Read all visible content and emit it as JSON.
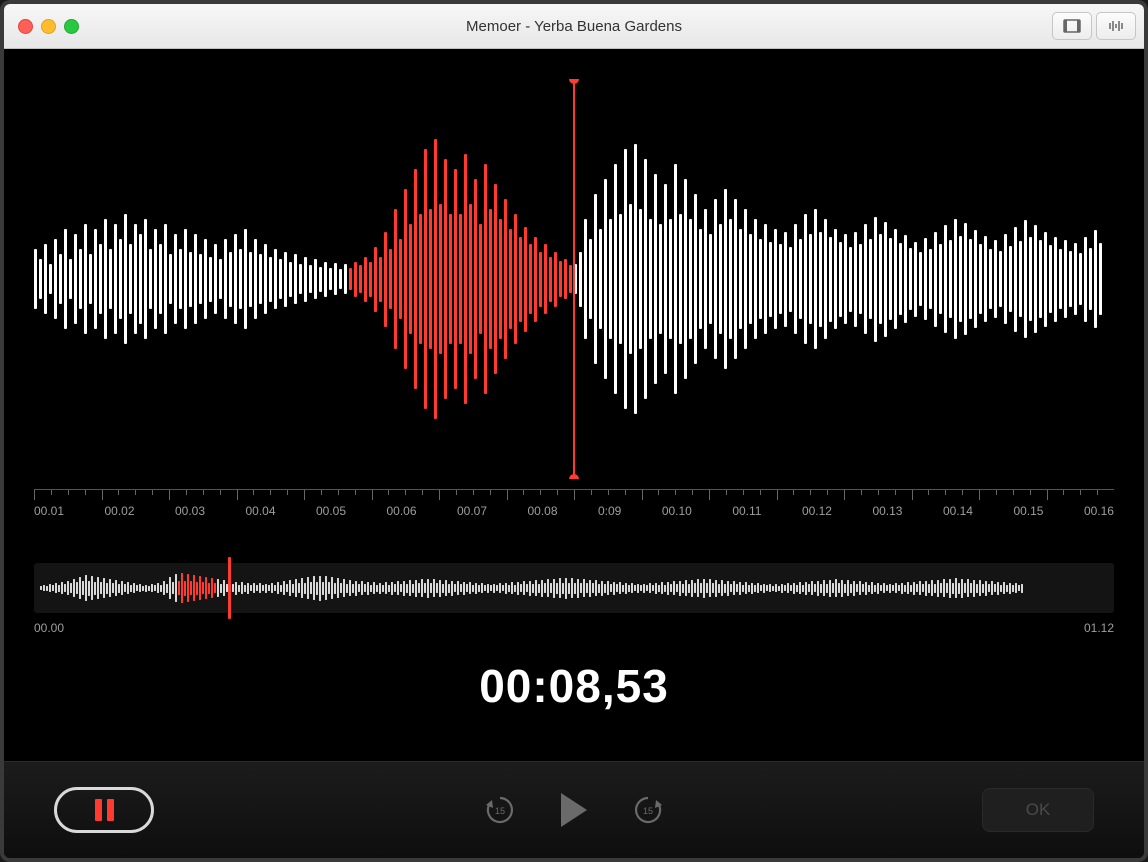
{
  "window": {
    "title": "Memoer - Yerba Buena Gardens"
  },
  "ruler": {
    "labels": [
      "00.01",
      "00.02",
      "00.03",
      "00.04",
      "00.05",
      "00.06",
      "00.07",
      "00.08",
      "0:09",
      "00.10",
      "00.11",
      "00.12",
      "00.13",
      "00.14",
      "00.15",
      "00.16"
    ]
  },
  "overview": {
    "start": "00.00",
    "end": "01.12",
    "playhead_ratio": 0.18
  },
  "timecode": "00:08,53",
  "controls": {
    "ok_label": "OK"
  },
  "waveform": {
    "main": {
      "red_start": 63,
      "red_end": 108,
      "playhead_index": 108,
      "heights": [
        60,
        40,
        70,
        30,
        80,
        50,
        100,
        40,
        90,
        60,
        110,
        50,
        100,
        70,
        120,
        60,
        110,
        80,
        130,
        70,
        110,
        90,
        120,
        60,
        100,
        70,
        110,
        50,
        90,
        60,
        100,
        55,
        90,
        50,
        80,
        45,
        70,
        40,
        80,
        55,
        90,
        60,
        100,
        55,
        80,
        50,
        70,
        45,
        60,
        40,
        55,
        35,
        50,
        30,
        45,
        28,
        40,
        25,
        35,
        22,
        32,
        20,
        30,
        22,
        35,
        28,
        45,
        35,
        65,
        45,
        95,
        60,
        140,
        80,
        180,
        110,
        220,
        130,
        260,
        140,
        280,
        150,
        240,
        130,
        220,
        130,
        250,
        150,
        200,
        110,
        230,
        140,
        190,
        120,
        160,
        100,
        130,
        85,
        105,
        70,
        85,
        55,
        70,
        45,
        55,
        36,
        40,
        28,
        30,
        55,
        120,
        80,
        170,
        100,
        200,
        120,
        230,
        130,
        260,
        150,
        270,
        140,
        240,
        120,
        210,
        110,
        190,
        120,
        230,
        130,
        200,
        120,
        170,
        100,
        140,
        90,
        160,
        110,
        180,
        120,
        160,
        100,
        140,
        90,
        120,
        80,
        110,
        75,
        100,
        70,
        95,
        65,
        110,
        80,
        130,
        90,
        140,
        95,
        120,
        85,
        100,
        75,
        90,
        65,
        95,
        70,
        110,
        80,
        125,
        90,
        115,
        82,
        100,
        72,
        88,
        62,
        75,
        54,
        82,
        60,
        95,
        70,
        108,
        78,
        120,
        86,
        112,
        80,
        98,
        70,
        86,
        60,
        78,
        56,
        90,
        66,
        105,
        76,
        118,
        84,
        108,
        78,
        95,
        68,
        85,
        60,
        78,
        56,
        72,
        52,
        85,
        62,
        98,
        72
      ]
    },
    "overview_heights": [
      4,
      6,
      5,
      8,
      6,
      10,
      7,
      12,
      8,
      14,
      10,
      18,
      12,
      22,
      14,
      26,
      15,
      24,
      13,
      22,
      12,
      20,
      11,
      18,
      10,
      16,
      9,
      14,
      8,
      12,
      7,
      10,
      6,
      8,
      5,
      7,
      5,
      8,
      6,
      10,
      7,
      14,
      9,
      22,
      12,
      28,
      14,
      30,
      15,
      28,
      14,
      26,
      13,
      24,
      12,
      22,
      11,
      20,
      10,
      18,
      9,
      16,
      8,
      14,
      8,
      13,
      7,
      12,
      7,
      11,
      6,
      10,
      6,
      10,
      6,
      9,
      6,
      10,
      6,
      12,
      7,
      14,
      8,
      16,
      9,
      18,
      10,
      20,
      11,
      22,
      12,
      24,
      13,
      25,
      13,
      24,
      12,
      22,
      11,
      20,
      10,
      18,
      9,
      16,
      9,
      15,
      8,
      14,
      8,
      13,
      7,
      12,
      7,
      11,
      7,
      12,
      7,
      13,
      8,
      14,
      8,
      15,
      9,
      16,
      9,
      17,
      10,
      18,
      10,
      19,
      10,
      18,
      10,
      17,
      9,
      16,
      9,
      15,
      8,
      14,
      8,
      13,
      8,
      12,
      7,
      11,
      7,
      10,
      6,
      9,
      6,
      9,
      6,
      10,
      6,
      11,
      7,
      12,
      7,
      13,
      8,
      14,
      8,
      15,
      9,
      16,
      9,
      17,
      10,
      18,
      10,
      19,
      11,
      20,
      11,
      21,
      11,
      20,
      11,
      19,
      10,
      18,
      10,
      17,
      10,
      16,
      9,
      15,
      9,
      14,
      8,
      13,
      8,
      12,
      7,
      11,
      7,
      10,
      6,
      9,
      6,
      9,
      6,
      10,
      6,
      11,
      7,
      12,
      7,
      13,
      8,
      14,
      8,
      15,
      9,
      16,
      9,
      17,
      10,
      18,
      10,
      19,
      10,
      18,
      10,
      17,
      9,
      16,
      9,
      15,
      8,
      14,
      8,
      13,
      7,
      12,
      7,
      11,
      7,
      10,
      6,
      9,
      6,
      8,
      5,
      8,
      5,
      9,
      6,
      10,
      6,
      11,
      7,
      12,
      7,
      13,
      8,
      14,
      8,
      15,
      9,
      16,
      9,
      17,
      10,
      18,
      10,
      17,
      9,
      16,
      9,
      15,
      8,
      14,
      8,
      13,
      7,
      12,
      7,
      11,
      6,
      10,
      6,
      9,
      6,
      10,
      6,
      11,
      7,
      12,
      7,
      13,
      8,
      14,
      8,
      15,
      9,
      16,
      9,
      17,
      10,
      18,
      10,
      19,
      11,
      20,
      11,
      19,
      10,
      18,
      10,
      17,
      9,
      16,
      9,
      15,
      8,
      14,
      8,
      13,
      7,
      12,
      7,
      11,
      7,
      10,
      6,
      9
    ]
  }
}
